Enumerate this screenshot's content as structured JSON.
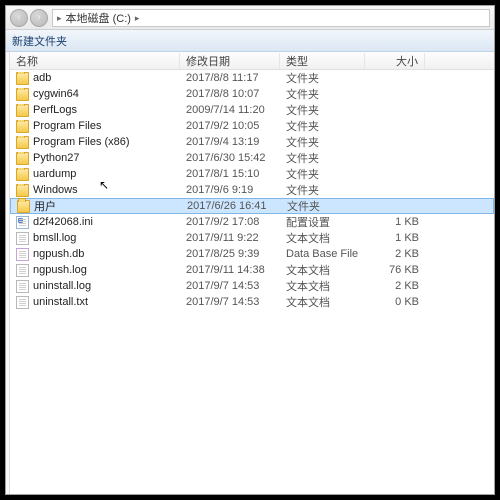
{
  "breadcrumb": {
    "drive": "本地磁盘 (C:)"
  },
  "toolbar": {
    "newfolder": "新建文件夹"
  },
  "columns": {
    "name": "名称",
    "date": "修改日期",
    "type": "类型",
    "size": "大小"
  },
  "selected_index": 8,
  "rows": [
    {
      "icon": "folder",
      "name": "adb",
      "date": "2017/8/8 11:17",
      "type": "文件夹",
      "size": ""
    },
    {
      "icon": "folder",
      "name": "cygwin64",
      "date": "2017/8/8 10:07",
      "type": "文件夹",
      "size": ""
    },
    {
      "icon": "folder",
      "name": "PerfLogs",
      "date": "2009/7/14 11:20",
      "type": "文件夹",
      "size": ""
    },
    {
      "icon": "folder",
      "name": "Program Files",
      "date": "2017/9/2 10:05",
      "type": "文件夹",
      "size": ""
    },
    {
      "icon": "folder",
      "name": "Program Files (x86)",
      "date": "2017/9/4 13:19",
      "type": "文件夹",
      "size": ""
    },
    {
      "icon": "folder",
      "name": "Python27",
      "date": "2017/6/30 15:42",
      "type": "文件夹",
      "size": ""
    },
    {
      "icon": "folder",
      "name": "uardump",
      "date": "2017/8/1 15:10",
      "type": "文件夹",
      "size": ""
    },
    {
      "icon": "folder",
      "name": "Windows",
      "date": "2017/9/6 9:19",
      "type": "文件夹",
      "size": ""
    },
    {
      "icon": "folder",
      "name": "用户",
      "date": "2017/6/26 16:41",
      "type": "文件夹",
      "size": ""
    },
    {
      "icon": "ini",
      "name": "d2f42068.ini",
      "date": "2017/9/2 17:08",
      "type": "配置设置",
      "size": "1 KB"
    },
    {
      "icon": "file",
      "name": "bmsll.log",
      "date": "2017/9/11 9:22",
      "type": "文本文档",
      "size": "1 KB"
    },
    {
      "icon": "db",
      "name": "ngpush.db",
      "date": "2017/8/25 9:39",
      "type": "Data Base File",
      "size": "2 KB"
    },
    {
      "icon": "file",
      "name": "ngpush.log",
      "date": "2017/9/11 14:38",
      "type": "文本文档",
      "size": "76 KB"
    },
    {
      "icon": "file",
      "name": "uninstall.log",
      "date": "2017/9/7 14:53",
      "type": "文本文档",
      "size": "2 KB"
    },
    {
      "icon": "file",
      "name": "uninstall.txt",
      "date": "2017/9/7 14:53",
      "type": "文本文档",
      "size": "0 KB"
    }
  ]
}
